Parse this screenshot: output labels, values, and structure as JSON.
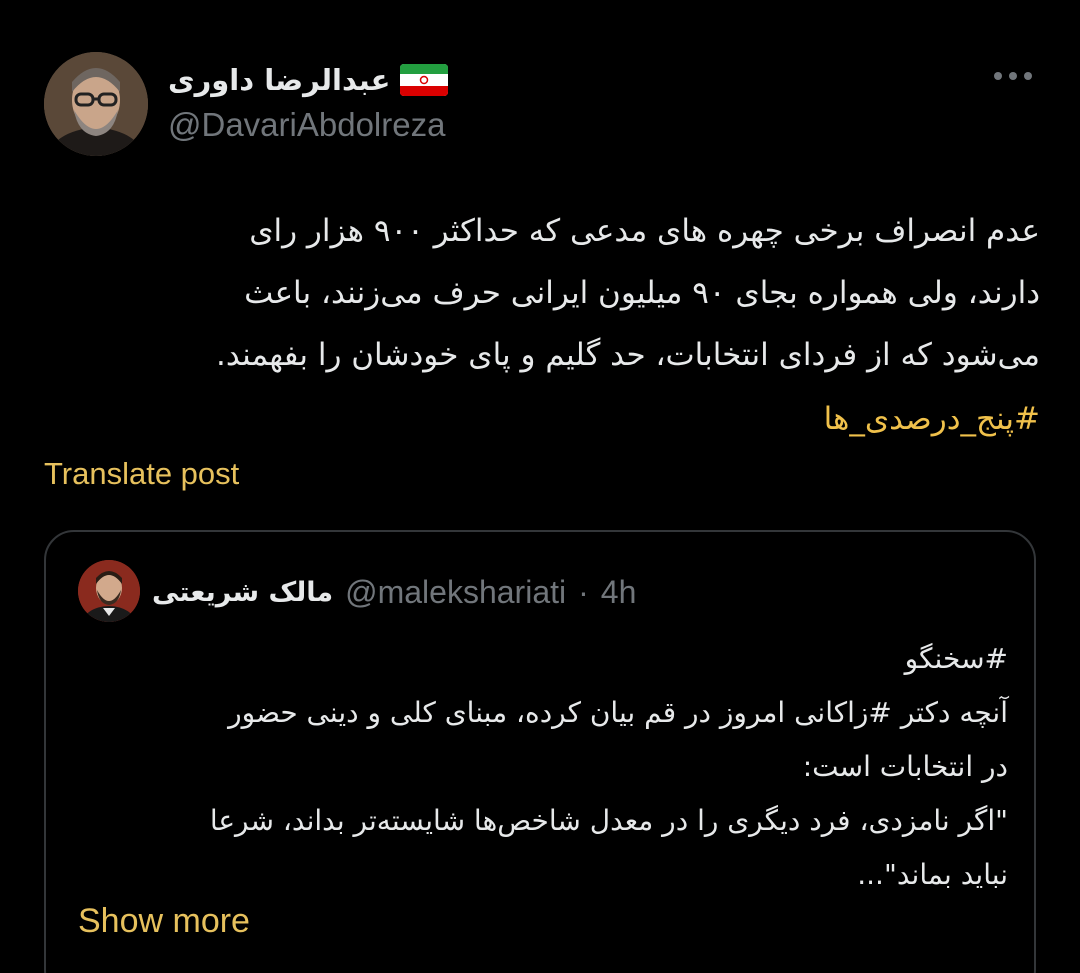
{
  "post": {
    "author": {
      "display_name": "عبدالرضا داوری",
      "handle": "@DavariAbdolreza",
      "avatar_icon": "profile-photo-avatar",
      "flag_icon": "iran-flag-icon"
    },
    "more_icon": "more-options-icon",
    "text": "عدم انصراف برخی چهره های مدعی که حداکثر ۹۰۰ هزار رای\nدارند، ولی همواره بجای ۹۰ میلیون ایرانی حرف می‌زنند، باعث\nمی‌شود که از فردای انتخابات، حد گلیم و پای خودشان را بفهمند.",
    "hashtag": "#پنج_درصدی_ها",
    "translate_label": "Translate post"
  },
  "quoted": {
    "author": {
      "display_name": "مالک شریعتی",
      "handle": "@malekshariati",
      "separator": "·",
      "time": "4h",
      "avatar_icon": "profile-photo-avatar"
    },
    "text": "#سخنگو\nآنچه دکتر #زاکانی امروز در قم بیان کرده، مبنای کلی و دینی حضور\nدر انتخابات است:\n\"اگر نامزدی، فرد دیگری را در معدل شاخص‌ها شایسته‌تر بداند، شرعا\nنباید بماند\"...",
    "show_more_label": "Show more"
  },
  "colors": {
    "background": "#000000",
    "text_primary": "#e7e9ea",
    "text_secondary": "#71767b",
    "accent_link": "#e7c15d",
    "border": "#333639"
  }
}
